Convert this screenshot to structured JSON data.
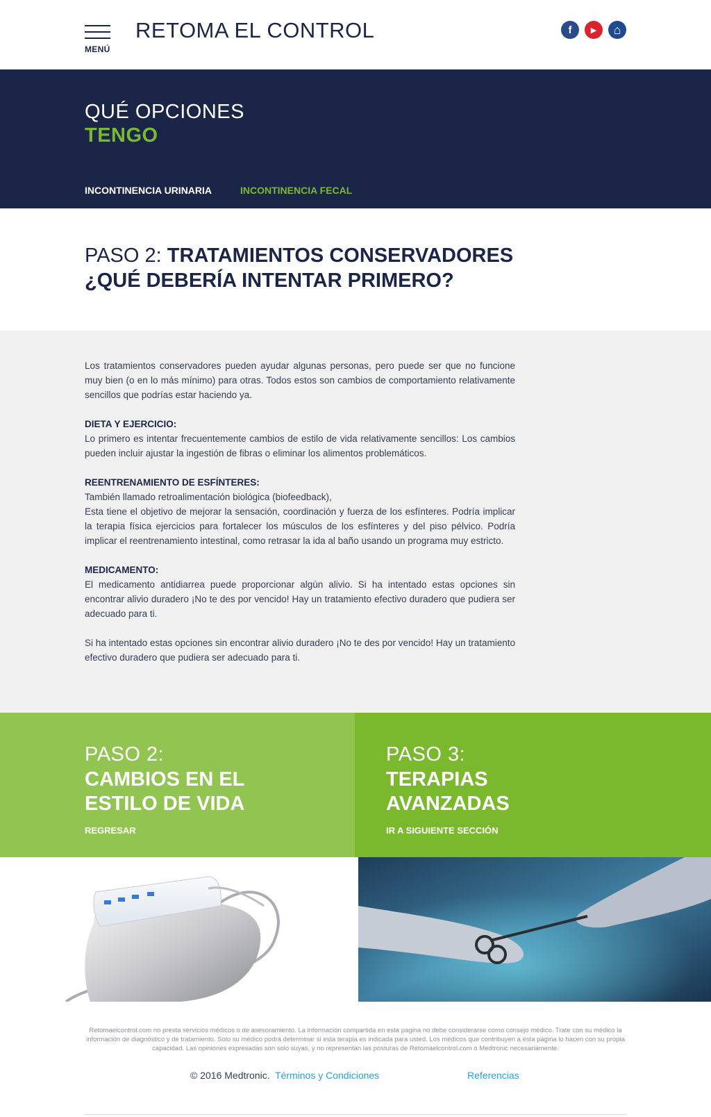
{
  "header": {
    "menu_label": "MENÚ",
    "site_title": "RETOMA EL CONTROL",
    "social": {
      "facebook": "f",
      "youtube": "▶",
      "home": "⌂"
    }
  },
  "hero": {
    "line1": "QUÉ OPCIONES",
    "line2": "TENGO",
    "tabs": [
      {
        "label": "INCONTINENCIA URINARIA",
        "active": false
      },
      {
        "label": "INCONTINENCIA FECAL",
        "active": true
      }
    ]
  },
  "step_heading": {
    "prefix": "PASO 2: ",
    "title": "TRATAMIENTOS CONSERVADORES",
    "subtitle": "¿QUÉ DEBERÍA INTENTAR PRIMERO?"
  },
  "content": {
    "intro": "Los tratamientos conservadores pueden ayudar algunas personas, pero puede ser que no funcione muy bien (o en lo más mínimo) para otras. Todos estos son cambios de comportamiento relativamente sencillos que podrías estar haciendo ya.",
    "sections": [
      {
        "heading": "DIETA Y EJERCICIO:",
        "text": "Lo primero es intentar frecuentemente cambios de estilo de vida relativamente sencillos: Los cambios pueden incluir ajustar la ingestión de fibras o eliminar los alimentos problemáticos."
      },
      {
        "heading": "REENTRENAMIENTO DE ESFÍNTERES:",
        "text": "También llamado retroalimentación biológica (biofeedback),",
        "text2": "Esta tiene el objetivo de mejorar la sensación, coordinación y fuerza de los esfínteres. Podría implicar la terapia física ejercicios para fortalecer los músculos de los esfínteres y del piso pélvico. Podría implicar el reentrenamiento intestinal, como retrasar la ida al baño usando un programa muy estricto."
      },
      {
        "heading": "MEDICAMENTO:",
        "text": "El medicamento antidiarrea puede proporcionar algún alivio. Si ha intentado estas opciones sin encontrar alivio duradero ¡No te des por vencido! Hay un tratamiento efectivo duradero que pudiera ser adecuado para ti."
      }
    ],
    "closing": "Si ha intentado estas opciones sin encontrar alivio duradero ¡No te des por vencido! Hay un tratamiento efectivo duradero que pudiera ser adecuado para ti."
  },
  "panels": [
    {
      "step": "PASO 2:",
      "title_line1": "CAMBIOS EN EL",
      "title_line2": "ESTILO DE VIDA",
      "link": "REGRESAR"
    },
    {
      "step": "PASO 3:",
      "title_line1": "TERAPIAS",
      "title_line2": "AVANZADAS",
      "link": "IR A SIGUIENTE SECCIÓN"
    }
  ],
  "footer": {
    "disclaimer": "Retomaelcontrol.com no presta servicios médicos o de asesoramiento. La información compartida en esta pagina no debe considerarse como consejo médico. Trate con su médico la información de diagnóstico y de tratamiento. Solo su médico podrá determinar si esta terapia es indicada para usted. Los médicos que contribuyen a esta página lo hacen con su propia capacidad. Las opiniones expresadas son solo suyas, y no representan las posturas de Retomaelcontrol.com o Medtronic necesariamente.",
    "copyright": "© 2016 Medtronic.",
    "terms": "Términos y Condiciones",
    "references": "Referencias"
  },
  "colors": {
    "navy": "#1b2548",
    "green_accent": "#7ab934",
    "panel_left": "#92c452",
    "panel_right": "#7ab92e",
    "content_bg": "#f0f0f0",
    "link": "#2a9fd8"
  }
}
